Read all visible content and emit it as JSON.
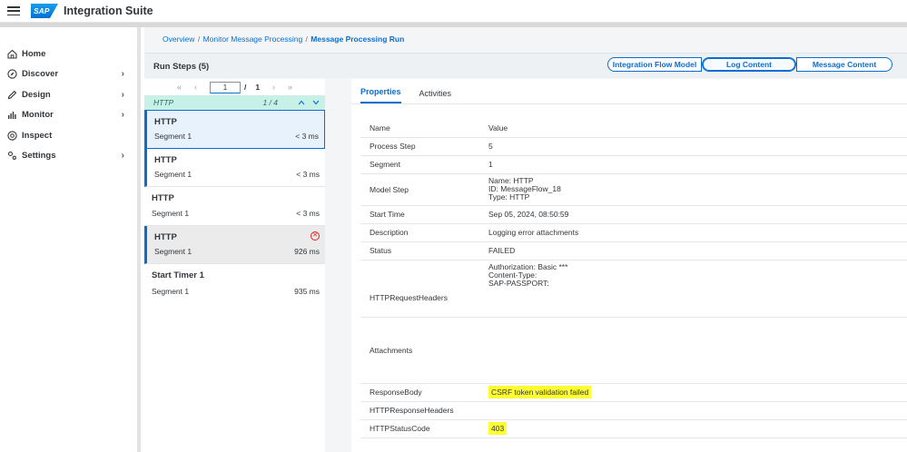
{
  "shell": {
    "brand": "SAP",
    "title": "Integration Suite"
  },
  "nav": [
    {
      "label": "Home",
      "icon": "home-icon",
      "has_children": false
    },
    {
      "label": "Discover",
      "icon": "compass-icon",
      "has_children": true
    },
    {
      "label": "Design",
      "icon": "pencil-icon",
      "has_children": true
    },
    {
      "label": "Monitor",
      "icon": "bar-chart-icon",
      "has_children": true
    },
    {
      "label": "Inspect",
      "icon": "inspect-icon",
      "has_children": false
    },
    {
      "label": "Settings",
      "icon": "settings-icon",
      "has_children": true
    }
  ],
  "breadcrumb": {
    "items": [
      "Overview",
      "Monitor Message Processing"
    ],
    "current": "Message Processing Run",
    "separator": "/"
  },
  "run_steps": {
    "title": "Run Steps (5)",
    "pager": {
      "first": "«",
      "prev": "‹",
      "page": "1",
      "of": "/",
      "total": "1",
      "next": "›",
      "last": "»"
    },
    "filter": {
      "label": "HTTP",
      "count": "1 / 4",
      "up": "^",
      "down": "v"
    },
    "items": [
      {
        "name": "HTTP",
        "segment": "Segment 1",
        "time": "< 3 ms",
        "state": "selected"
      },
      {
        "name": "HTTP",
        "segment": "Segment 1",
        "time": "< 3 ms",
        "state": "bar"
      },
      {
        "name": "HTTP",
        "segment": "Segment 1",
        "time": "< 3 ms",
        "state": "plain"
      },
      {
        "name": "HTTP",
        "segment": "Segment 1",
        "time": "926 ms",
        "state": "error"
      },
      {
        "name": "Start Timer 1",
        "segment": "Segment 1",
        "time": "935 ms",
        "state": "plain"
      }
    ]
  },
  "top_tabs": [
    "Integration Flow Model",
    "Log Content",
    "Message Content"
  ],
  "panel_tabs": [
    "Properties",
    "Activities"
  ],
  "table": {
    "headers": [
      "Name",
      "Value"
    ],
    "rows": [
      {
        "name": "Process Step",
        "value": "5"
      },
      {
        "name": "Segment",
        "value": "1"
      },
      {
        "name": "Model Step",
        "value_lines": [
          "Name: HTTP",
          "ID: MessageFlow_18",
          "Type: HTTP"
        ]
      },
      {
        "name": "Start Time",
        "value": "Sep 05, 2024, 08:50:59"
      },
      {
        "name": "Description",
        "value": "Logging error attachments"
      },
      {
        "name": "Status",
        "value": "FAILED"
      },
      {
        "name": "HTTPRequestHeaders",
        "value_lines": [
          "Authorization: Basic ***",
          "Content-Type:",
          "SAP-PASSPORT:"
        ]
      },
      {
        "name": "Attachments",
        "value": ""
      },
      {
        "name": "ResponseBody",
        "value": "CSRF token validation failed",
        "highlight": true
      },
      {
        "name": "HTTPResponseHeaders",
        "value": ""
      },
      {
        "name": "HTTPStatusCode",
        "value": "403",
        "highlight": true
      }
    ]
  },
  "colors": {
    "accent": "#0a6ed1",
    "highlight": "#ffff33",
    "error": "#e9201f",
    "filter_bg": "#c7f0e6"
  }
}
